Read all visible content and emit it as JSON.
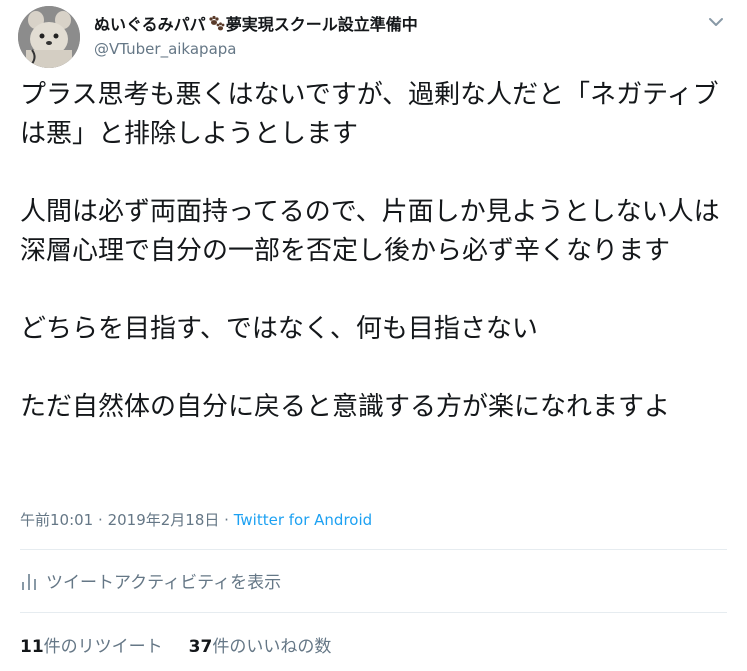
{
  "user": {
    "display_name_part1": "ぬいぐるみパパ",
    "display_name_part2": "夢実現スクール設立準備中",
    "handle": "@VTuber_aikapapa"
  },
  "tweet": {
    "paragraphs": [
      "プラス思考も悪くはないですが、過剰な人だと「ネガティブは悪」と排除しようとします",
      "人間は必ず両面持ってるので、片面しか見ようとしない人は深層心理で自分の一部を否定し後から必ず辛くなります",
      "どちらを目指す、ではなく、何も目指さない",
      "ただ自然体の自分に戻ると意識する方が楽になれますよ"
    ],
    "time": "午前10:01",
    "separator": "·",
    "date": "2019年2月18日",
    "source": "Twitter for Android"
  },
  "activity": {
    "label": "ツイートアクティビティを表示"
  },
  "stats": {
    "retweets_count": "11",
    "retweets_label": "件のリツイート",
    "likes_count": "37",
    "likes_label": "件のいいねの数"
  },
  "colors": {
    "text": "#14171a",
    "secondary": "#657786",
    "link": "#1da1f2",
    "divider": "#e6ecf0"
  },
  "icons": {
    "avatar": "plush-toy-avatar",
    "name_emoji": "paw-prints-icon",
    "caret": "chevron-down-icon",
    "activity": "bar-chart-icon"
  }
}
